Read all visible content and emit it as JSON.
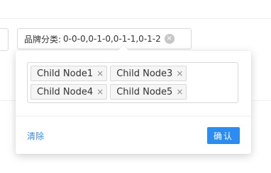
{
  "filter": {
    "label": "品牌分类:",
    "value": "0-0-0,0-1-0,0-1-1,0-1-2",
    "clear_glyph": "×"
  },
  "popover": {
    "tags": [
      {
        "label": "Child Node1",
        "close_glyph": "×"
      },
      {
        "label": "Child Node3",
        "close_glyph": "×"
      },
      {
        "label": "Child Node4",
        "close_glyph": "×"
      },
      {
        "label": "Child Node5",
        "close_glyph": "×"
      }
    ],
    "reset_label": "清除",
    "confirm_label": "确认"
  },
  "colors": {
    "accent": "#2d8cf0",
    "border": "#d9d9d9",
    "tag_bg": "#f5f5f5"
  }
}
